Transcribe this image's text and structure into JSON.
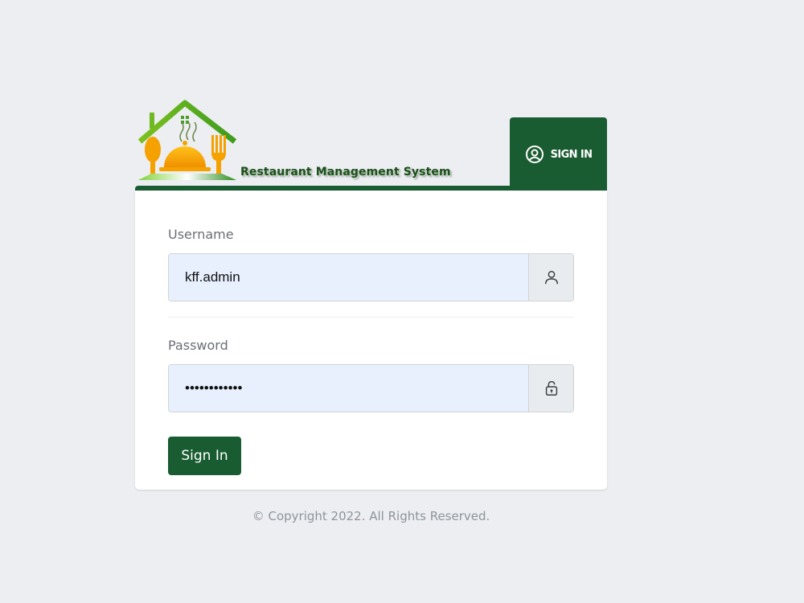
{
  "logo": {
    "text": "Restaurant Management System",
    "icon": "restaurant-house-logo"
  },
  "tab": {
    "label": "SIGN IN",
    "icon": "user-circle-icon"
  },
  "form": {
    "username": {
      "label": "Username",
      "value": "kff.admin",
      "icon": "user-icon"
    },
    "password": {
      "label": "Password",
      "value": "••••••••••••",
      "icon": "lock-icon"
    },
    "submit_label": "Sign In"
  },
  "footer": {
    "copyright": "© Copyright 2022. All Rights Reserved."
  },
  "colors": {
    "brand_green": "#1a5c31",
    "background": "#eceef2",
    "input_autofill": "#e8f0fe"
  }
}
